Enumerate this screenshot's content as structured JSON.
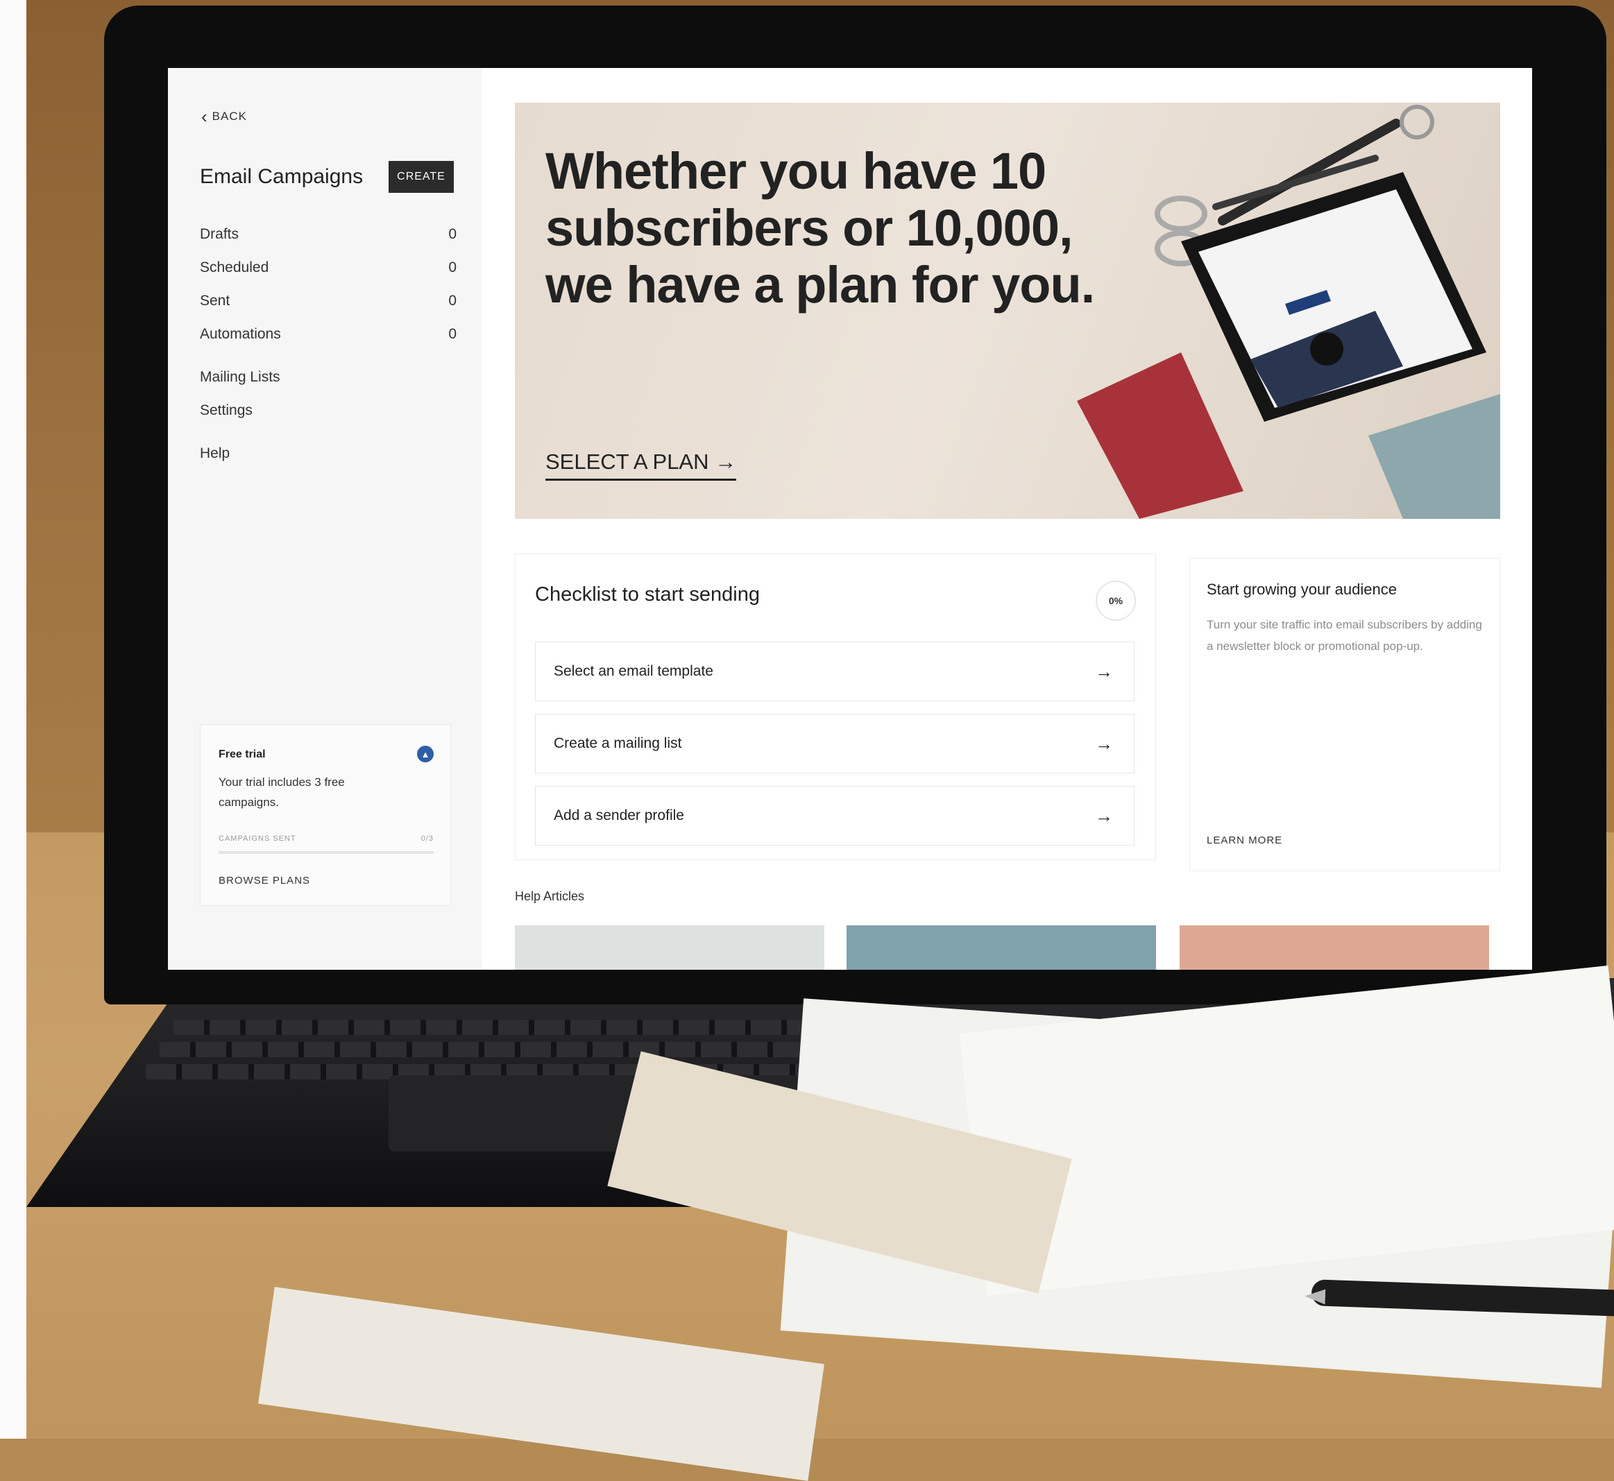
{
  "sidebar": {
    "back_label": "BACK",
    "title": "Email Campaigns",
    "create_label": "CREATE",
    "nav_counts": [
      {
        "label": "Drafts",
        "count": "0"
      },
      {
        "label": "Scheduled",
        "count": "0"
      },
      {
        "label": "Sent",
        "count": "0"
      },
      {
        "label": "Automations",
        "count": "0"
      }
    ],
    "nav_links": [
      {
        "label": "Mailing Lists"
      },
      {
        "label": "Settings"
      }
    ],
    "help_label": "Help",
    "trial": {
      "title": "Free trial",
      "text": "Your trial includes 3 free campaigns.",
      "meta_label": "CAMPAIGNS SENT",
      "meta_value": "0/3",
      "progress_fraction": 0,
      "browse_label": "BROWSE PLANS"
    }
  },
  "hero": {
    "headline": "Whether you have 10 subscribers or 10,000, we have a plan for you.",
    "cta_label": "SELECT A PLAN →"
  },
  "checklist": {
    "title": "Checklist to start sending",
    "progress": "0%",
    "items": [
      {
        "label": "Select an email template"
      },
      {
        "label": "Create a mailing list"
      },
      {
        "label": "Add a sender profile"
      }
    ],
    "arrow": "→"
  },
  "audience": {
    "title": "Start growing your audience",
    "text": "Turn your site traffic into email subscribers by adding a newsletter block or promotional pop-up.",
    "cta_label": "LEARN MORE"
  },
  "help": {
    "title": "Help Articles",
    "card_colors": [
      "#dde1df",
      "#7fa2ad",
      "#dda892"
    ]
  },
  "icons": {
    "back": "chevron-left-icon",
    "trial": "chevron-up-icon",
    "arrow": "arrow-right-icon"
  },
  "colors": {
    "create_button": "#2b2b2b",
    "trial_icon": "#2f5ea8",
    "hero_background": "#e6dbd0"
  }
}
